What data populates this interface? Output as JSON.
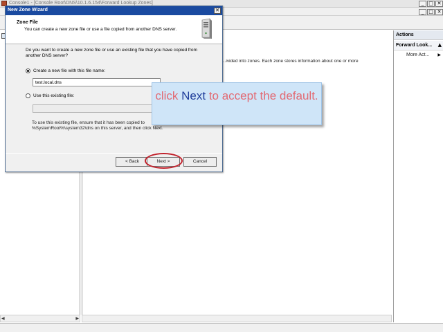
{
  "console": {
    "title": "Console1 - [Console Root\\DNS\\10.1.6.154\\Forward Lookup Zones]",
    "content_text": "...ivided into zones. Each zone stores information about one or more",
    "window_controls": [
      "_",
      "□",
      "✕"
    ],
    "actions": {
      "header": "Actions",
      "section": "Forward Look...",
      "section_arrow": "▲",
      "more": "More Act...",
      "more_arrow": "▶"
    },
    "scroll_arrows": [
      "◀",
      "▶"
    ]
  },
  "wizard": {
    "title": "New Zone Wizard",
    "close": "✕",
    "header_title": "Zone File",
    "header_subtitle": "You can create a new zone file or use a file copied from another DNS server.",
    "question": "Do you want to create a new zone file or use an existing file that you have copied from another DNS server?",
    "option_new_label": "Create a new file with this file name:",
    "option_new_selected": true,
    "file_name_value": "test.local.dns",
    "option_existing_label": "Use this existing file:",
    "existing_file_value": "",
    "info_text": "To use this existing file, ensure that it has been copied to %SystemRoot%\\system32\\dns on this server, and then click Next.",
    "buttons": {
      "back": "< Back",
      "next": "Next >",
      "cancel": "Cancel"
    }
  },
  "callout": {
    "pre": "click ",
    "highlight": "Next",
    "post": " to accept the default."
  },
  "colors": {
    "callout_text": "#e26a73",
    "callout_highlight": "#1f3d9a",
    "callout_background": "#cfe5f8",
    "wizard_titlebar": "#1a4aa0",
    "highlight_circle": "#c0202a"
  }
}
